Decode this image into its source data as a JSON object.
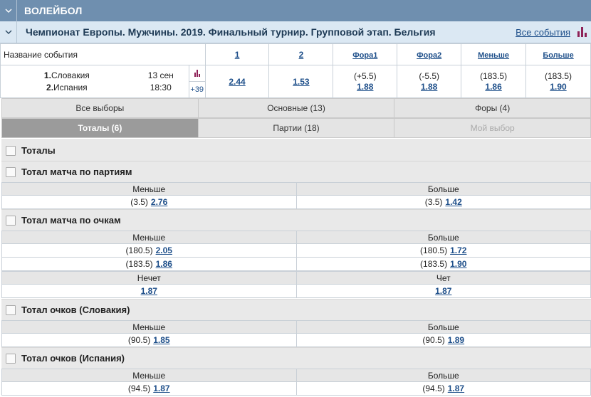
{
  "sport": {
    "title": "ВОЛЕЙБОЛ"
  },
  "tournament": {
    "title": "Чемпионат Европы. Мужчины. 2019. Финальный турнир. Групповой этап. Бельгия",
    "all_events": "Все события"
  },
  "market_header": {
    "name": "Название события",
    "cols": [
      "1",
      "2",
      "Фора1",
      "Фора2",
      "Меньше",
      "Больше"
    ]
  },
  "event": {
    "team1_num": "1.",
    "team1": "Словакия",
    "team2_num": "2.",
    "team2": "Испания",
    "date": "13 сен",
    "time": "18:30",
    "more": "+39",
    "odd1": "2.44",
    "odd2": "1.53",
    "fora1_line": "(+5.5)",
    "fora1_odd": "1.88",
    "fora2_line": "(-5.5)",
    "fora2_odd": "1.88",
    "under_line": "(183.5)",
    "under_odd": "1.86",
    "over_line": "(183.5)",
    "over_odd": "1.90"
  },
  "tabs": {
    "row1": [
      "Все выборы",
      "Основные (13)",
      "Форы (4)"
    ],
    "row2": [
      "Тоталы (6)",
      "Партии (18)",
      "Мой выбор"
    ]
  },
  "sections": {
    "totals": "Тоталы",
    "sets_total": {
      "title": "Тотал матча по партиям",
      "under": "Меньше",
      "over": "Больше",
      "rows": [
        {
          "ul": "(3.5)",
          "uo": "2.76",
          "ol": "(3.5)",
          "oo": "1.42"
        }
      ]
    },
    "points_total": {
      "title": "Тотал матча по очкам",
      "under": "Меньше",
      "over": "Больше",
      "rows": [
        {
          "ul": "(180.5)",
          "uo": "2.05",
          "ol": "(180.5)",
          "oo": "1.72"
        },
        {
          "ul": "(183.5)",
          "uo": "1.86",
          "ol": "(183.5)",
          "oo": "1.90"
        }
      ],
      "odd": "Нечет",
      "even": "Чет",
      "odd_val": "1.87",
      "even_val": "1.87"
    },
    "slovakia_total": {
      "title": "Тотал очков (Словакия)",
      "under": "Меньше",
      "over": "Больше",
      "rows": [
        {
          "ul": "(90.5)",
          "uo": "1.85",
          "ol": "(90.5)",
          "oo": "1.89"
        }
      ]
    },
    "spain_total": {
      "title": "Тотал очков (Испания)",
      "under": "Меньше",
      "over": "Больше",
      "rows": [
        {
          "ul": "(94.5)",
          "uo": "1.87",
          "ol": "(94.5)",
          "oo": "1.87"
        }
      ]
    }
  }
}
